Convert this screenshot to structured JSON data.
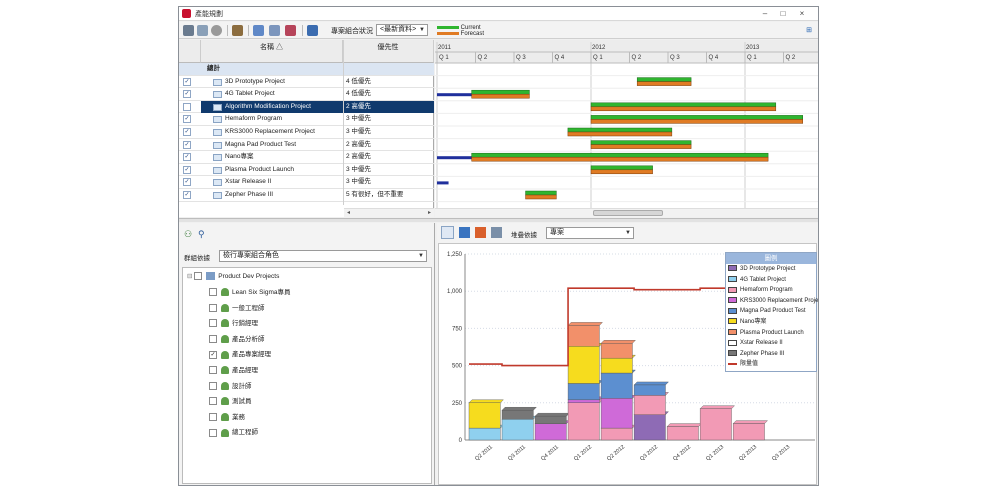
{
  "window": {
    "title": "產能規劃"
  },
  "toolbar": {
    "combo_label": "專案組合狀況",
    "combo_value": "<最新資料>",
    "legend_current": "Current",
    "legend_forecast": "Forecast"
  },
  "grid": {
    "col_name": "名稱 △",
    "col_priority": "優先性",
    "group_label": "總計",
    "rows": [
      {
        "name": "3D Prototype Project",
        "priority": "4 低優先",
        "checked": true,
        "selected": false
      },
      {
        "name": "4G Tablet Project",
        "priority": "4 低優先",
        "checked": true,
        "selected": false
      },
      {
        "name": "Algorithm Modification Project",
        "priority": "2 高優先",
        "checked": false,
        "selected": true
      },
      {
        "name": "Hemaform Program",
        "priority": "3 中優先",
        "checked": true,
        "selected": false
      },
      {
        "name": "KRS3000 Replacement Project",
        "priority": "3 中優先",
        "checked": true,
        "selected": false
      },
      {
        "name": "Magna Pad Product Test",
        "priority": "2 高優先",
        "checked": true,
        "selected": false
      },
      {
        "name": "Nano專案",
        "priority": "2 高優先",
        "checked": true,
        "selected": false
      },
      {
        "name": "Plasma Product Launch",
        "priority": "3 中優先",
        "checked": true,
        "selected": false
      },
      {
        "name": "Xstar Release II",
        "priority": "3 中優先",
        "checked": true,
        "selected": false
      },
      {
        "name": "Zepher Phase III",
        "priority": "5 有很好，但不重要",
        "checked": true,
        "selected": false
      }
    ]
  },
  "gantt": {
    "years": [
      "2011",
      "2012",
      "2013"
    ],
    "quarters": [
      "Q 1",
      "Q 2",
      "Q 3",
      "Q 4",
      "Q 1",
      "Q 2",
      "Q 3",
      "Q 4",
      "Q 1",
      "Q 2",
      "Q 3"
    ],
    "bars": [
      {
        "row": 0,
        "start": 5.2,
        "end": 6.6,
        "current": true,
        "forecast": true
      },
      {
        "row": 1,
        "start": 0.9,
        "end": 2.4,
        "current": true,
        "forecast": true,
        "blue_start": 0,
        "blue_end": 0.9
      },
      {
        "row": 2,
        "start": 4.0,
        "end": 8.8,
        "current": true,
        "forecast": true
      },
      {
        "row": 3,
        "start": 4.0,
        "end": 9.5,
        "current": true,
        "forecast": true
      },
      {
        "row": 4,
        "start": 3.4,
        "end": 6.1,
        "current": true,
        "forecast": true
      },
      {
        "row": 5,
        "start": 4.0,
        "end": 6.6,
        "current": true,
        "forecast": true
      },
      {
        "row": 6,
        "start": 0.9,
        "end": 8.6,
        "current": true,
        "forecast": true,
        "blue_start": 0,
        "blue_end": 0.9
      },
      {
        "row": 7,
        "start": 4.0,
        "end": 5.6,
        "current": true,
        "forecast": true
      },
      {
        "row": 8,
        "start": 0,
        "end": 0.3,
        "current": false,
        "forecast": false,
        "blue_start": 0,
        "blue_end": 0.3
      },
      {
        "row": 9,
        "start": 2.3,
        "end": 3.1,
        "current": true,
        "forecast": true
      }
    ]
  },
  "left": {
    "group_by_label": "群組依據",
    "group_by_value": "檢行專案組合角色",
    "root": "Product Dev Projects",
    "roles": [
      {
        "name": "Lean Six Sigma專員",
        "checked": false
      },
      {
        "name": "一般工程師",
        "checked": false
      },
      {
        "name": "行銷經理",
        "checked": false
      },
      {
        "name": "產品分析師",
        "checked": false
      },
      {
        "name": "產品專案經理",
        "checked": true
      },
      {
        "name": "產品經理",
        "checked": false
      },
      {
        "name": "設計師",
        "checked": false
      },
      {
        "name": "測試員",
        "checked": false
      },
      {
        "name": "業務",
        "checked": false
      },
      {
        "name": "總工程師",
        "checked": false
      }
    ]
  },
  "right": {
    "stack_label": "堆疊依據",
    "stack_value": "專案"
  },
  "colors": {
    "accent": "#103a6d",
    "current": "#2fb52f",
    "forecast": "#e07b24",
    "limit": "#c0392b"
  },
  "chart_data": {
    "type": "bar",
    "stacked": true,
    "title": "",
    "legend_title": "圖例",
    "categories": [
      "Q2 2011",
      "Q3 2011",
      "Q4 2011",
      "Q1 2012",
      "Q2 2012",
      "Q3 2012",
      "Q4 2012",
      "Q1 2013",
      "Q2 2013",
      "Q3 2013"
    ],
    "ylim": [
      0,
      1250
    ],
    "yticks": [
      "0",
      "250",
      "500",
      "750",
      "1,000",
      "1,250"
    ],
    "series": [
      {
        "name": "3D Prototype Project",
        "color": "#8e6bb5",
        "values": [
          0,
          0,
          0,
          0,
          0,
          170,
          0,
          0,
          0,
          0
        ]
      },
      {
        "name": "4G Tablet Project",
        "color": "#8fd0ee",
        "values": [
          80,
          140,
          0,
          0,
          0,
          0,
          0,
          0,
          0,
          0
        ]
      },
      {
        "name": "Hemaform Program",
        "color": "#f29ab5",
        "values": [
          0,
          0,
          0,
          250,
          80,
          130,
          90,
          210,
          110,
          0
        ]
      },
      {
        "name": "KRS3000 Replacement Project",
        "color": "#cf6ad8",
        "values": [
          0,
          0,
          110,
          20,
          200,
          0,
          0,
          0,
          0,
          0
        ]
      },
      {
        "name": "Magna Pad Product Test",
        "color": "#5c8fd0",
        "values": [
          0,
          0,
          0,
          110,
          170,
          70,
          0,
          0,
          0,
          0
        ]
      },
      {
        "name": "Nano專案",
        "color": "#f6dc1e",
        "values": [
          170,
          0,
          0,
          250,
          100,
          0,
          0,
          0,
          0,
          0
        ]
      },
      {
        "name": "Plasma Product Launch",
        "color": "#f2906a",
        "values": [
          0,
          0,
          0,
          140,
          100,
          0,
          0,
          0,
          0,
          0
        ]
      },
      {
        "name": "Xstar Release II",
        "color": "#ffffff",
        "values": [
          0,
          0,
          0,
          0,
          0,
          0,
          0,
          0,
          0,
          0
        ]
      },
      {
        "name": "Zepher Phase III",
        "color": "#777777",
        "values": [
          0,
          60,
          50,
          0,
          0,
          0,
          0,
          0,
          0,
          0
        ]
      }
    ],
    "limit": {
      "name": "限量值",
      "color": "#c0392b",
      "values": [
        510,
        500,
        500,
        1020,
        1020,
        1010,
        1010,
        1020,
        1010,
        1020
      ]
    }
  }
}
